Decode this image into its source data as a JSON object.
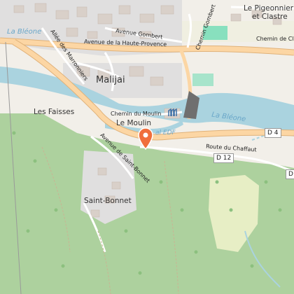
{
  "map": {
    "labels": {
      "town_maliijai": "Malijai",
      "les_faisses": "Les Faisses",
      "le_moulin": "Le Moulin",
      "saint_bonnet": "Saint-Bonnet",
      "le_pigeonnier": "Le Pigeonnier",
      "et_clastre": "et Clastre",
      "la_bleone_left": "La Bléone",
      "la_bleone_right": "La Bléone",
      "canal_edf": "al EDF",
      "chemin_du_moulin": "Chemin du Moulin",
      "avenue_haute_provence": "Avenue de la Haute-Provence",
      "avenue_gombert": "Avenue Gombert",
      "chemin_gombert": "Chemin Gombert",
      "chemin_clastre": "Chemin de Clastre",
      "allee_marronniers": "Allée des Marronniers",
      "avenue_saint_bonnet": "Avenue de Saint-Bonnet",
      "route_chaffaut": "Route du Chaffaut"
    },
    "shields": {
      "d4": "D 4",
      "d12": "D 12",
      "d_edge": "D"
    },
    "icons": {
      "marker": "map-pin-icon",
      "utility": "pumping-station-icon"
    },
    "colors": {
      "land": "#f2efe9",
      "forest": "#add19e",
      "water": "#aad3df",
      "major_road": "#fcd6a4",
      "road_casing": "#e0b27a",
      "minor_road": "#ffffff",
      "building": "#d9d0c9",
      "marker": "#f06e3c",
      "sports": "#88e0be"
    }
  }
}
